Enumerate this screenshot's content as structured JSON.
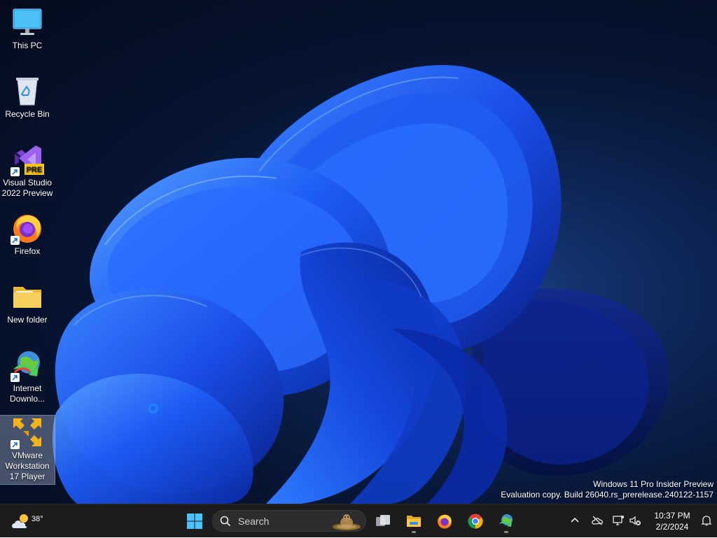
{
  "desktop": {
    "icons": [
      {
        "label": "This PC",
        "icon": "monitor-icon",
        "shortcut": false
      },
      {
        "label": "Recycle Bin",
        "icon": "recycle-bin-icon",
        "shortcut": false
      },
      {
        "label": "Visual Studio\n2022 Preview",
        "icon": "visual-studio-preview-icon",
        "badge": "PRE",
        "shortcut": true
      },
      {
        "label": "Firefox",
        "icon": "firefox-icon",
        "shortcut": true
      },
      {
        "label": "New folder",
        "icon": "folder-icon",
        "shortcut": false
      },
      {
        "label": "Internet\nDownlo...",
        "icon": "internet-download-manager-icon",
        "shortcut": true
      },
      {
        "label": "VMware\nWorkstation\n17 Player",
        "icon": "vmware-player-icon",
        "shortcut": true,
        "selected": true
      }
    ],
    "watermark": {
      "line1": "Windows 11 Pro Insider Preview",
      "line2": "Evaluation copy. Build 26040.rs_prerelease.240122-1157"
    }
  },
  "taskbar": {
    "weather": {
      "temperature": "38°",
      "icon": "partly-cloudy-icon"
    },
    "search": {
      "placeholder": "Search"
    },
    "pinned": [
      {
        "name": "start-button",
        "icon": "windows-logo-icon"
      },
      {
        "name": "task-view-button",
        "icon": "task-view-icon"
      },
      {
        "name": "file-explorer-button",
        "icon": "file-explorer-icon",
        "running": true
      },
      {
        "name": "firefox-taskbar-button",
        "icon": "firefox-icon"
      },
      {
        "name": "chrome-taskbar-button",
        "icon": "chrome-icon"
      },
      {
        "name": "idm-taskbar-button",
        "icon": "internet-download-manager-icon",
        "running": true
      }
    ],
    "tray": {
      "time": "10:37 PM",
      "date": "2/2/2024"
    }
  },
  "colors": {
    "accent": "#1e63ff",
    "taskbar": "#1c1c1c",
    "wallpaper_bg": "#071431"
  }
}
